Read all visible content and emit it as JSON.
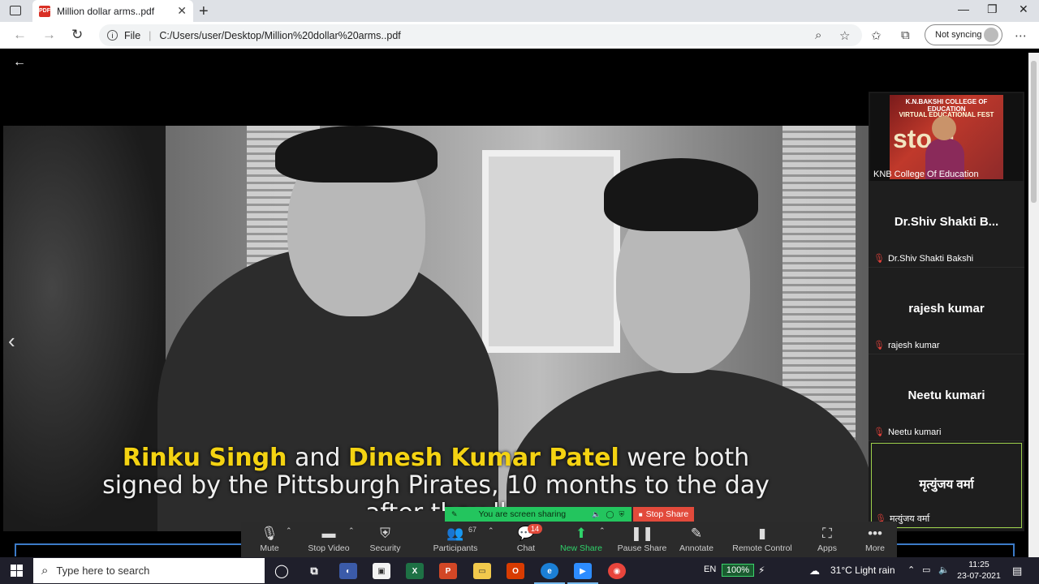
{
  "browser": {
    "tab_title": "Million dollar arms..pdf",
    "tab_icon": "PDF",
    "url_scheme": "File",
    "url": "C:/Users/user/Desktop/Million%20dollar%20arms..pdf",
    "sync_label": "Not syncing"
  },
  "slide": {
    "caption_line1_hl1": "Rinku Singh",
    "caption_line1_mid": " and ",
    "caption_line1_hl2": "Dinesh Kumar Patel",
    "caption_line1_end": " were both",
    "caption_line2": "signed by the Pittsburgh Pirates, 10 months to the day",
    "caption_line3": "after they                        ll"
  },
  "gallery": {
    "video_tile": {
      "banner1": "K.N.BAKSHI COLLEGE OF EDUCATION",
      "banner2": "VIRTUAL EDUCATIONAL FEST",
      "big_text": "sto  g",
      "name": "KNB College Of Education"
    },
    "tiles": [
      {
        "big": "Dr.Shiv  Shakti  B...",
        "small": "Dr.Shiv Shakti Bakshi"
      },
      {
        "big": "rajesh kumar",
        "small": "rajesh kumar"
      },
      {
        "big": "Neetu kumari",
        "small": "Neetu kumari"
      },
      {
        "big": "मृत्युंजय वर्मा",
        "small": "मृत्युंजय वर्मा"
      }
    ]
  },
  "share": {
    "banner": "You are screen sharing",
    "stop": "Stop Share"
  },
  "zoom": {
    "mute": "Mute",
    "stop_video": "Stop Video",
    "security": "Security",
    "participants": "Participants",
    "participants_count": "67",
    "chat": "Chat",
    "chat_badge": "14",
    "new_share": "New Share",
    "pause_share": "Pause Share",
    "annotate": "Annotate",
    "remote_control": "Remote Control",
    "apps": "Apps",
    "more": "More"
  },
  "taskbar": {
    "search_placeholder": "Type here to search",
    "lang": "EN",
    "battery": "100%",
    "weather": "31°C  Light rain",
    "time": "11:25",
    "date": "23-07-2021"
  },
  "colors": {
    "share_green": "#23c55e",
    "stop_red": "#e24a3b",
    "caption_yellow": "#f4d312"
  }
}
